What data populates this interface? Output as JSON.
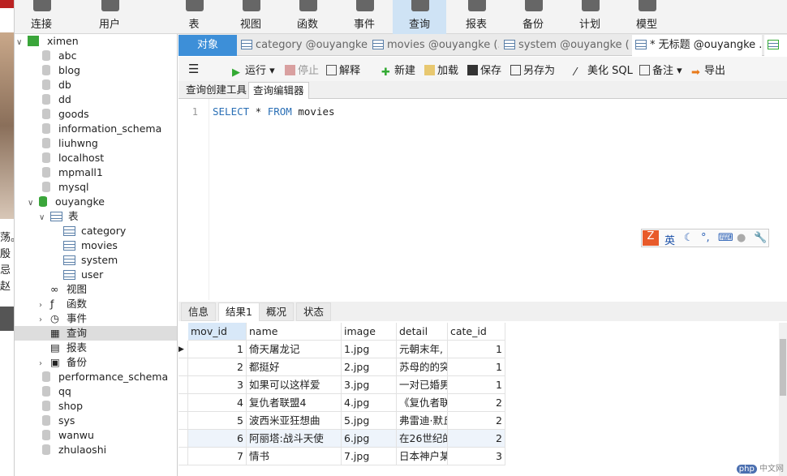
{
  "toolbar": {
    "items": [
      {
        "label": "连接"
      },
      {
        "label": "用户"
      },
      {
        "label": "表"
      },
      {
        "label": "视图"
      },
      {
        "label": "函数"
      },
      {
        "label": "事件"
      },
      {
        "label": "查询",
        "active": true
      },
      {
        "label": "报表"
      },
      {
        "label": "备份"
      },
      {
        "label": "计划"
      },
      {
        "label": "模型"
      }
    ]
  },
  "left_window": {
    "fragments": [
      "荡。",
      "殷",
      "忌",
      "赵"
    ]
  },
  "tree": {
    "connection": "ximen",
    "databases_before": [
      "abc",
      "blog",
      "db",
      "dd",
      "goods",
      "information_schema",
      "liuhwng",
      "localhost",
      "mpmall1",
      "mysql"
    ],
    "open_db": "ouyangke",
    "tables_label": "表",
    "tables": [
      "category",
      "movies",
      "system",
      "user"
    ],
    "groups": [
      "视图",
      "函数",
      "事件",
      "查询",
      "报表",
      "备份"
    ],
    "databases_after": [
      "performance_schema",
      "qq",
      "shop",
      "sys",
      "wanwu",
      "zhulaoshi"
    ]
  },
  "tabs": [
    "对象",
    "category @ouyangke...",
    "movies @ouyangke (...",
    "system @ouyangke (...",
    "* 无标题 @ouyangke ..."
  ],
  "query_toolbar": {
    "run": "运行",
    "stop": "停止",
    "explain": "解释",
    "new": "新建",
    "load": "加载",
    "save": "保存",
    "save_as": "另存为",
    "beautify": "美化 SQL",
    "comment": "备注",
    "export": "导出"
  },
  "subtabs": [
    "查询创建工具",
    "查询编辑器"
  ],
  "editor": {
    "line": "1",
    "kw1": "SELECT",
    "mid": " * ",
    "kw2": "FROM",
    "rest": " movies"
  },
  "ime": {
    "label": "英"
  },
  "result_tabs": [
    "信息",
    "结果1",
    "概况",
    "状态"
  ],
  "grid": {
    "columns": [
      "mov_id",
      "name",
      "image",
      "detail",
      "cate_id"
    ],
    "rows": [
      [
        "1",
        "倚天屠龙记",
        "1.jpg",
        "元朝末年,",
        "1"
      ],
      [
        "2",
        "都挺好",
        "2.jpg",
        " 苏母的的突",
        "1"
      ],
      [
        "3",
        "如果可以这样爱",
        "3.jpg",
        "一对已婚男",
        "1"
      ],
      [
        "4",
        "复仇者联盟4",
        "4.jpg",
        "《复仇者联",
        "2"
      ],
      [
        "5",
        "波西米亚狂想曲",
        "5.jpg",
        "弗雷迪·默丘",
        "2"
      ],
      [
        "6",
        "阿丽塔:战斗天使",
        "6.jpg",
        "在26世纪的",
        "2"
      ],
      [
        "7",
        "情书",
        "7.jpg",
        "日本神户某",
        "3"
      ]
    ]
  },
  "watermark": {
    "badge": "php",
    "text": "中文网"
  }
}
